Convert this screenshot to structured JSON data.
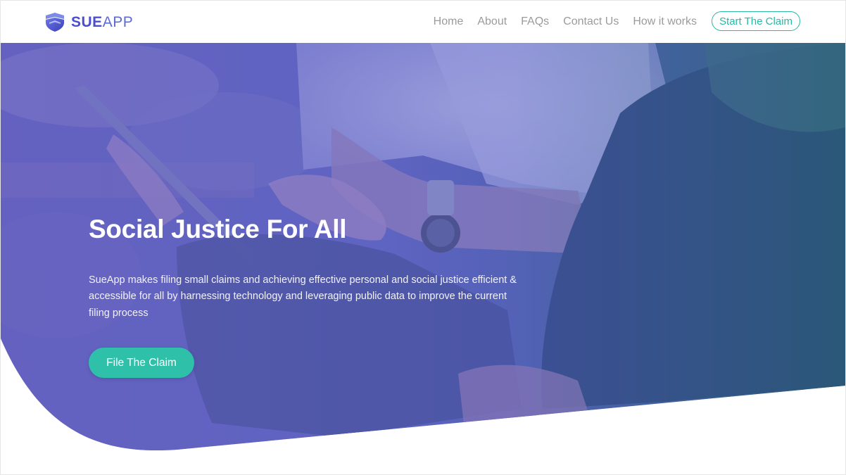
{
  "brand": {
    "name_bold": "SUE",
    "name_light": "APP",
    "logo_icon": "shield-logo-icon",
    "color_primary": "#4a4fd0",
    "color_accent": "#27b9a3"
  },
  "nav": {
    "items": [
      {
        "label": "Home"
      },
      {
        "label": "About"
      },
      {
        "label": "FAQs"
      },
      {
        "label": "Contact Us"
      },
      {
        "label": "How it works"
      }
    ],
    "cta_label": "Start The Claim"
  },
  "hero": {
    "title": "Social Justice For All",
    "description": "SueApp makes filing small claims and achieving effective personal and social justice efficient & accessible for all by harnessing technology and leveraging public data to improve the current filing process",
    "cta_label": "File The Claim",
    "overlay_color": "#5560c6"
  }
}
